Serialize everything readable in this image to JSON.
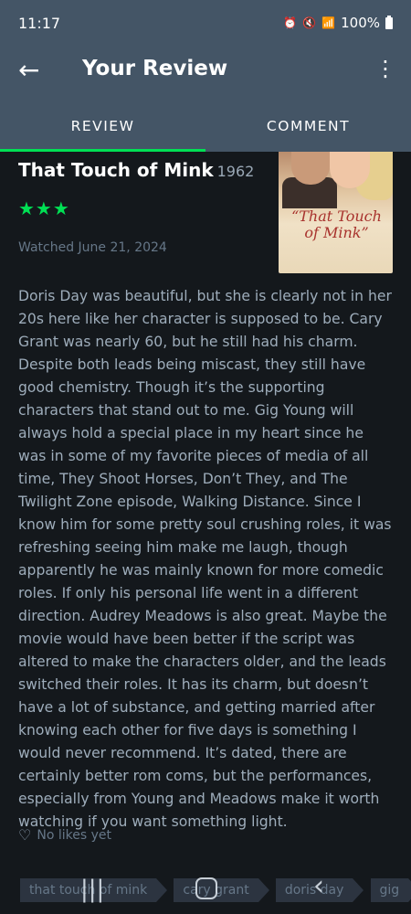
{
  "status_bar": {
    "time": "11:17",
    "icons": [
      "alarm-icon",
      "mute-icon",
      "wifi-icon",
      "signal-icon"
    ],
    "battery": "100%"
  },
  "app_bar": {
    "title": "Your Review",
    "back_icon": "arrow-left-icon",
    "more_icon": "more-vertical-icon"
  },
  "tabs": [
    {
      "label": "REVIEW",
      "active": true
    },
    {
      "label": "COMMENT",
      "active": false
    }
  ],
  "film": {
    "title": "That Touch of Mink",
    "year": "1962",
    "rating_stars": 3,
    "stars_text": "★★★",
    "poster_text": "“That Touch of Mink”"
  },
  "watched": "Watched June 21, 2024",
  "review": "Doris Day was beautiful, but she is clearly not in her 20s here like her character is supposed to be. Cary Grant was nearly 60, but he still had his charm. Despite both leads being miscast, they still have good chemistry. Though it’s the supporting characters that stand out to me. Gig Young will always hold a special place in my heart since he was in some of my favorite pieces of media of all time, They Shoot Horses, Don’t They, and The Twilight Zone episode, Walking Distance. Since I know him for some pretty soul crushing roles, it was refreshing seeing him make me laugh, though apparently he was mainly known for more comedic roles. If only his personal life went in a different direction. Audrey Meadows is also great. Maybe the movie would have been better if the script was altered to make the characters older, and the leads switched their roles. It has its charm, but doesn’t have a lot of substance, and getting married after knowing each other for five days is something I would never recommend. It’s dated, there are certainly better rom coms, but the performances, especially from Young and Meadows make it worth watching if you want something light.",
  "likes": "No likes yet",
  "tags": [
    "that touch of mink",
    "cary grant",
    "doris day",
    "gig"
  ],
  "accent_color": "#00e054",
  "header_color": "#445566",
  "background_color": "#14181c"
}
